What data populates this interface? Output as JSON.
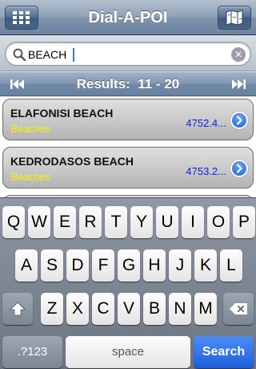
{
  "navbar": {
    "title": "Dial-A-POI",
    "left_icon": "grid-menu-icon",
    "right_icon": "map-icon"
  },
  "search": {
    "value": "BEACH",
    "placeholder": ""
  },
  "results": {
    "label": "Results:  11 - 20"
  },
  "list": [
    {
      "name": "ELAFONISI BEACH",
      "category": "Beaches",
      "distance": "4752.4..."
    },
    {
      "name": "KEDRODASOS BEACH",
      "category": "Beaches",
      "distance": "4753.2..."
    }
  ],
  "keyboard": {
    "row1": [
      "Q",
      "W",
      "E",
      "R",
      "T",
      "Y",
      "U",
      "I",
      "O",
      "P"
    ],
    "row2": [
      "A",
      "S",
      "D",
      "F",
      "G",
      "H",
      "J",
      "K",
      "L"
    ],
    "row3": [
      "Z",
      "X",
      "C",
      "V",
      "B",
      "N",
      "M"
    ],
    "numbers_label": ".?123",
    "space_label": "space",
    "search_label": "Search"
  },
  "colors": {
    "category_text": "#ffee00",
    "distance_text": "#1122dd",
    "search_key": "#1f5fdb"
  }
}
